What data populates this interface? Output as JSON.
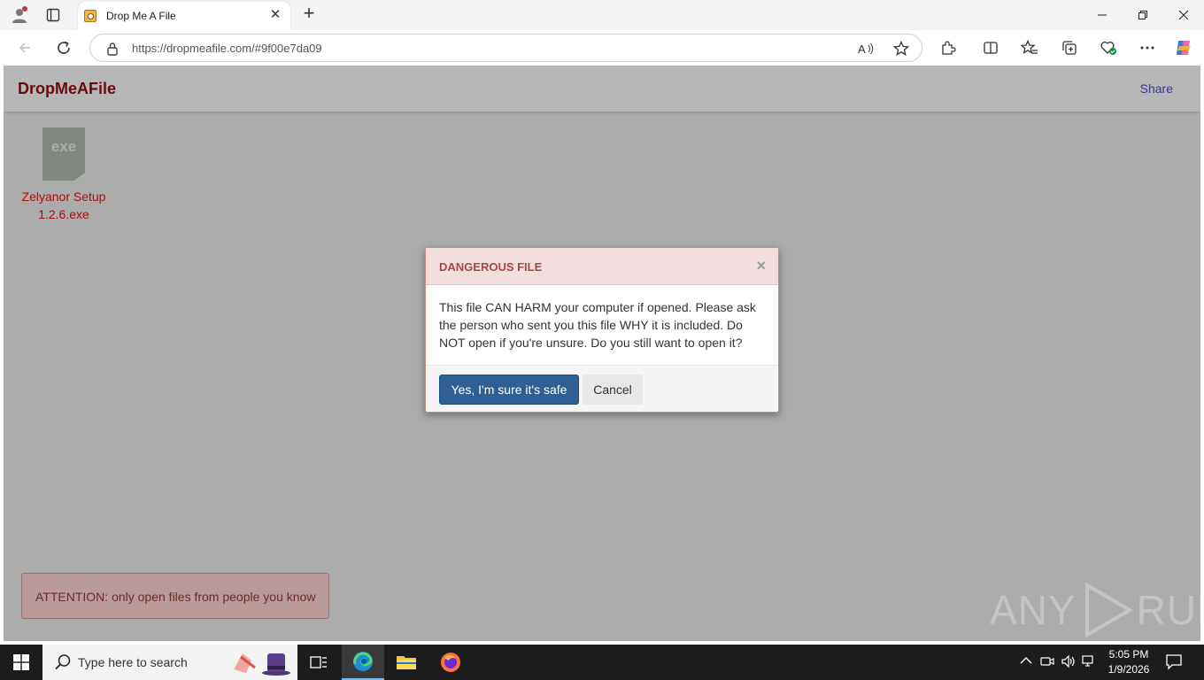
{
  "browser": {
    "tab_title": "Drop Me A File",
    "url": "https://dropmeafile.com/#9f00e7da09"
  },
  "site": {
    "brand": "DropMeAFile",
    "share_label": "Share"
  },
  "file": {
    "icon_label": "exe",
    "name_line1": "Zelyanor Setup",
    "name_line2": "1.2.6.exe"
  },
  "attention_text": "ATTENTION: only open files from people you know",
  "watermark": {
    "left": "ANY",
    "right": "RUN"
  },
  "modal": {
    "title": "DANGEROUS FILE",
    "close_glyph": "×",
    "body": "This file CAN HARM your computer if opened. Please ask the person who sent you this file WHY it is included. Do NOT open if you're unsure. Do you still want to open it?",
    "confirm_label": "Yes, I'm sure it's safe",
    "cancel_label": "Cancel"
  },
  "taskbar": {
    "search_placeholder": "Type here to search",
    "time": "5:05 PM",
    "date": "1/9/2026"
  },
  "colors": {
    "brand": "#6b0a0a",
    "link": "#36368a",
    "danger_header": "#f2dede",
    "danger_text": "#a94442",
    "primary_button": "#2e6096",
    "overlay": "#acacac"
  }
}
